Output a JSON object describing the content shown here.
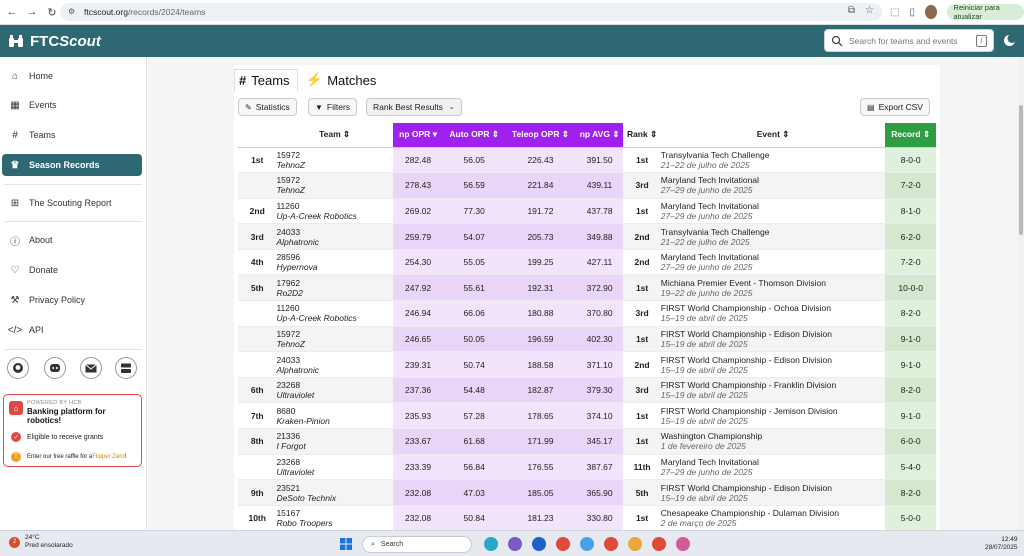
{
  "browser": {
    "url_host": "ftcscout.org",
    "url_path": "/records/2024/teams",
    "update_label": "Reiniciar para atualizar"
  },
  "header": {
    "brand_ftc": "FTC",
    "brand_scout": "Scout",
    "search_placeholder": "Search for teams and events",
    "search_shortcut": "/"
  },
  "sidebar": {
    "items": [
      {
        "label": "Home",
        "icon": "home-icon"
      },
      {
        "label": "Events",
        "icon": "calendar-icon"
      },
      {
        "label": "Teams",
        "icon": "hashtag-icon"
      },
      {
        "label": "Season Records",
        "icon": "trophy-icon"
      },
      {
        "label": "The Scouting Report",
        "icon": "binoculars-icon"
      },
      {
        "label": "About",
        "icon": "info-icon"
      },
      {
        "label": "Donate",
        "icon": "donate-icon"
      },
      {
        "label": "Privacy Policy",
        "icon": "gavel-icon"
      },
      {
        "label": "API",
        "icon": "code-icon"
      }
    ],
    "hcb": {
      "powered": "POWERED BY HCB",
      "title": "Banking platform for robotics!",
      "eligible": "Eligible to receive grants",
      "raffle_prefix": "Enter our free raffle for a ",
      "raffle_link": "Flipper Zero",
      "raffle_suffix": "!"
    }
  },
  "tabs": [
    {
      "label": "Teams",
      "icon": "hashtag-icon"
    },
    {
      "label": "Matches",
      "icon": "bolt-icon"
    }
  ],
  "toolbar": {
    "statistics": "Statistics",
    "filters": "Filters",
    "rank_select": "Rank Best Results",
    "export": "Export CSV"
  },
  "table": {
    "headers": {
      "team": "Team",
      "np_opr": "np OPR",
      "auto_opr": "Auto OPR",
      "teleop_opr": "Teleop OPR",
      "np_avg": "np AVG",
      "rank": "Rank",
      "event": "Event",
      "record": "Record"
    },
    "rows": [
      {
        "place": "1st",
        "num": "15972",
        "name": "TehnoZ",
        "np_opr": "282.48",
        "auto_opr": "56.05",
        "teleop_opr": "226.43",
        "np_avg": "391.50",
        "rank": "1st",
        "event": "Transylvania Tech Challenge",
        "date": "21–22 de julho de 2025",
        "record": "8-0-0"
      },
      {
        "place": "",
        "num": "15972",
        "name": "TehnoZ",
        "np_opr": "278.43",
        "auto_opr": "56.59",
        "teleop_opr": "221.84",
        "np_avg": "439.11",
        "rank": "3rd",
        "event": "Maryland Tech Invitational",
        "date": "27–29 de junho de 2025",
        "record": "7-2-0"
      },
      {
        "place": "2nd",
        "num": "11260",
        "name": "Up-A-Creek Robotics",
        "np_opr": "269.02",
        "auto_opr": "77.30",
        "teleop_opr": "191.72",
        "np_avg": "437.78",
        "rank": "1st",
        "event": "Maryland Tech Invitational",
        "date": "27–29 de junho de 2025",
        "record": "8-1-0"
      },
      {
        "place": "3rd",
        "num": "24033",
        "name": "Alphatronic",
        "np_opr": "259.79",
        "auto_opr": "54.07",
        "teleop_opr": "205.73",
        "np_avg": "349.88",
        "rank": "2nd",
        "event": "Transylvania Tech Challenge",
        "date": "21–22 de julho de 2025",
        "record": "6-2-0"
      },
      {
        "place": "4th",
        "num": "28596",
        "name": "Hypernova",
        "np_opr": "254.30",
        "auto_opr": "55.05",
        "teleop_opr": "199.25",
        "np_avg": "427.11",
        "rank": "2nd",
        "event": "Maryland Tech Invitational",
        "date": "27–29 de junho de 2025",
        "record": "7-2-0"
      },
      {
        "place": "5th",
        "num": "17962",
        "name": "Ro2D2",
        "np_opr": "247.92",
        "auto_opr": "55.61",
        "teleop_opr": "192.31",
        "np_avg": "372.90",
        "rank": "1st",
        "event": "Michiana Premier Event - Thomson Division",
        "date": "19–22 de junho de 2025",
        "record": "10-0-0"
      },
      {
        "place": "",
        "num": "11260",
        "name": "Up-A-Creek Robotics",
        "np_opr": "246.94",
        "auto_opr": "66.06",
        "teleop_opr": "180.88",
        "np_avg": "370.80",
        "rank": "3rd",
        "event": "FIRST World Championship - Ochoa Division",
        "date": "15–19 de abril de 2025",
        "record": "8-2-0"
      },
      {
        "place": "",
        "num": "15972",
        "name": "TehnoZ",
        "np_opr": "246.65",
        "auto_opr": "50.05",
        "teleop_opr": "196.59",
        "np_avg": "402.30",
        "rank": "1st",
        "event": "FIRST World Championship - Edison Division",
        "date": "15–19 de abril de 2025",
        "record": "9-1-0"
      },
      {
        "place": "",
        "num": "24033",
        "name": "Alphatronic",
        "np_opr": "239.31",
        "auto_opr": "50.74",
        "teleop_opr": "188.58",
        "np_avg": "371.10",
        "rank": "2nd",
        "event": "FIRST World Championship - Edison Division",
        "date": "15–19 de abril de 2025",
        "record": "9-1-0"
      },
      {
        "place": "6th",
        "num": "23268",
        "name": "Ultraviolet",
        "np_opr": "237.36",
        "auto_opr": "54.48",
        "teleop_opr": "182.87",
        "np_avg": "379.30",
        "rank": "3rd",
        "event": "FIRST World Championship - Franklin Division",
        "date": "15–19 de abril de 2025",
        "record": "8-2-0"
      },
      {
        "place": "7th",
        "num": "8680",
        "name": "Kraken-Pinion",
        "np_opr": "235.93",
        "auto_opr": "57.28",
        "teleop_opr": "178.65",
        "np_avg": "374.10",
        "rank": "1st",
        "event": "FIRST World Championship - Jemison Division",
        "date": "15–19 de abril de 2025",
        "record": "9-1-0"
      },
      {
        "place": "8th",
        "num": "21336",
        "name": "I Forgot",
        "np_opr": "233.67",
        "auto_opr": "61.68",
        "teleop_opr": "171.99",
        "np_avg": "345.17",
        "rank": "1st",
        "event": "Washington Championship",
        "date": "1 de fevereiro de 2025",
        "record": "6-0-0"
      },
      {
        "place": "",
        "num": "23268",
        "name": "Ultraviolet",
        "np_opr": "233.39",
        "auto_opr": "56.84",
        "teleop_opr": "176.55",
        "np_avg": "387.67",
        "rank": "11th",
        "event": "Maryland Tech Invitational",
        "date": "27–29 de junho de 2025",
        "record": "5-4-0"
      },
      {
        "place": "9th",
        "num": "23521",
        "name": "DeSoto Technix",
        "np_opr": "232.08",
        "auto_opr": "47.03",
        "teleop_opr": "185.05",
        "np_avg": "365.90",
        "rank": "5th",
        "event": "FIRST World Championship - Edison Division",
        "date": "15–19 de abril de 2025",
        "record": "8-2-0"
      },
      {
        "place": "10th",
        "num": "15167",
        "name": "Robo Troopers",
        "np_opr": "232.08",
        "auto_opr": "50.84",
        "teleop_opr": "181.23",
        "np_avg": "330.80",
        "rank": "1st",
        "event": "Chesapeake Championship - Dulaman Division",
        "date": "2 de março de 2025",
        "record": "5-0-0"
      }
    ]
  },
  "taskbar": {
    "temp": "24°C",
    "weather": "Pred ensolarado",
    "weather_badge": "2",
    "search": "Search",
    "time": "12:49",
    "date": "28/07/2025"
  }
}
